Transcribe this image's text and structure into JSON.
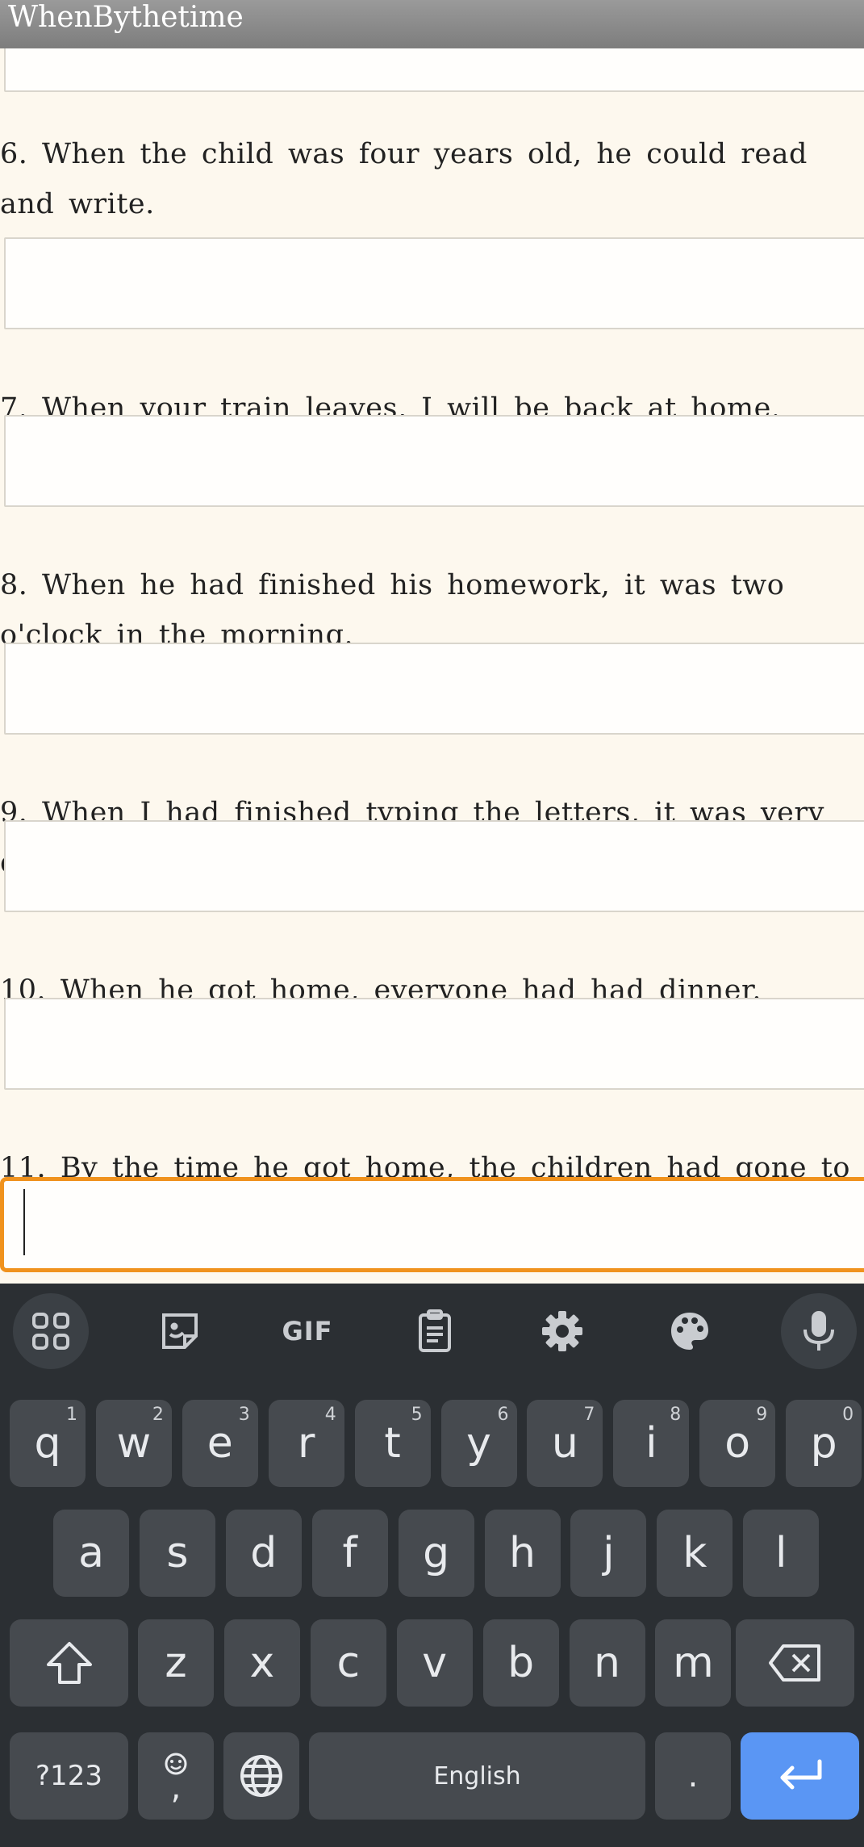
{
  "app": {
    "title": "WhenBythetime"
  },
  "questions": [
    {
      "number": "6.",
      "text": "When the child was four years old, he could read and write."
    },
    {
      "number": "7.",
      "text": "When your train leaves, I will be back at home."
    },
    {
      "number": "8.",
      "text": "When he had finished his homework, it was two o'clock in the morning."
    },
    {
      "number": "9.",
      "text": "When I had finished typing the letters, it was very dark."
    },
    {
      "number": "10.",
      "text": "When he got home, everyone had had dinner."
    },
    {
      "number": "11.",
      "text": "By the time he got home, the children had gone to bed."
    }
  ],
  "answers": [
    "",
    "",
    "",
    "",
    "",
    "",
    ""
  ],
  "keyboard": {
    "toolbar": [
      "apps-icon",
      "sticker-icon",
      "gif-icon",
      "clipboard-icon",
      "gear-icon",
      "palette-icon",
      "mic-icon"
    ],
    "gif_label": "GIF",
    "row1": [
      {
        "k": "q",
        "h": "1"
      },
      {
        "k": "w",
        "h": "2"
      },
      {
        "k": "e",
        "h": "3"
      },
      {
        "k": "r",
        "h": "4"
      },
      {
        "k": "t",
        "h": "5"
      },
      {
        "k": "y",
        "h": "6"
      },
      {
        "k": "u",
        "h": "7"
      },
      {
        "k": "i",
        "h": "8"
      },
      {
        "k": "o",
        "h": "9"
      },
      {
        "k": "p",
        "h": "0"
      }
    ],
    "row2": [
      "a",
      "s",
      "d",
      "f",
      "g",
      "h",
      "j",
      "k",
      "l"
    ],
    "row3": [
      "z",
      "x",
      "c",
      "v",
      "b",
      "n",
      "m"
    ],
    "symbols_label": "?123",
    "comma_label": ",",
    "space_label": "English",
    "period_label": ".",
    "colors": {
      "background": "#2b2f33",
      "key": "#464a4f",
      "enter": "#5a96f4",
      "focus": "#f0921d"
    }
  }
}
